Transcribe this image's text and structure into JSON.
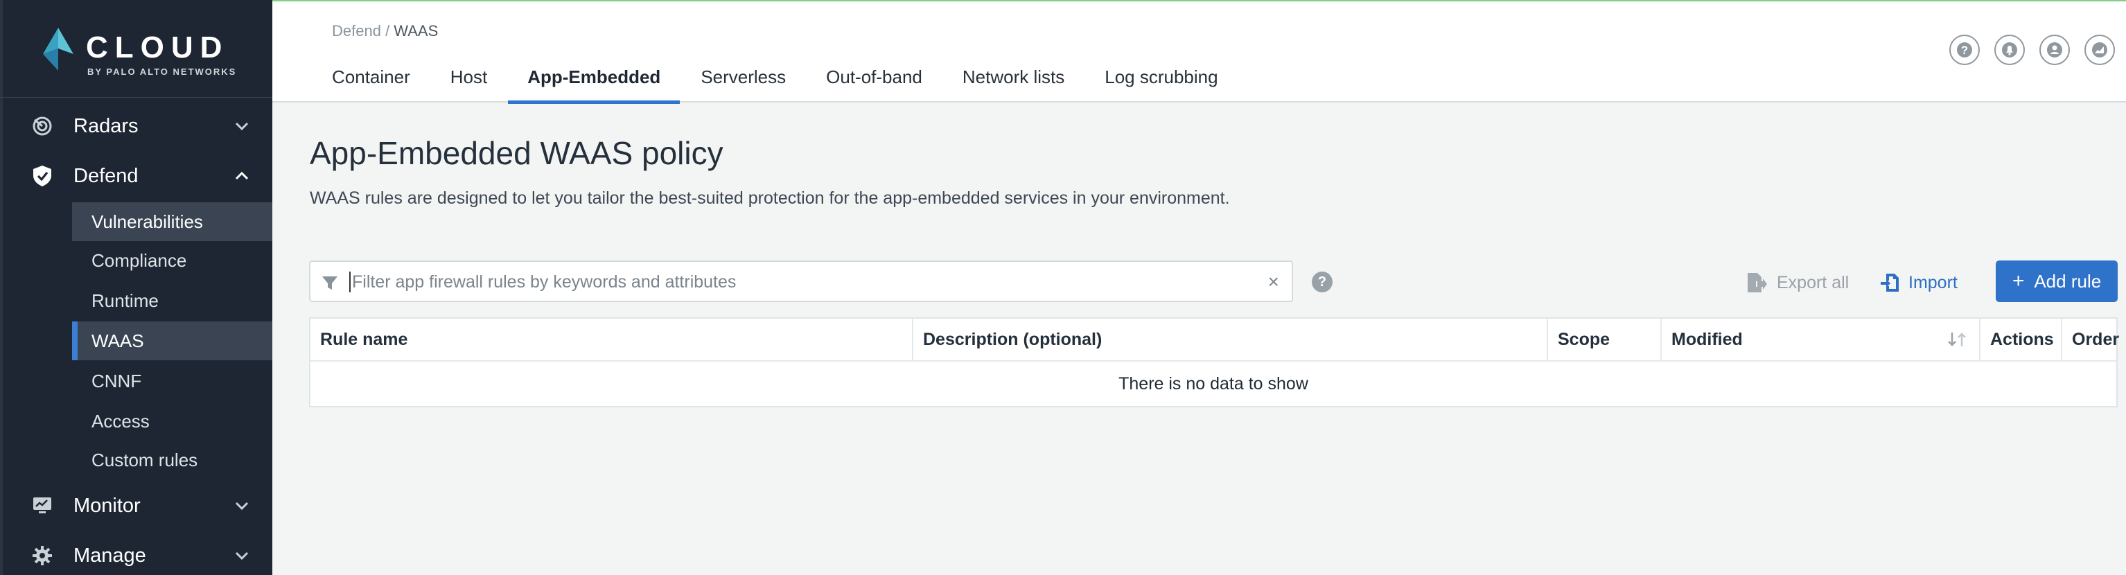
{
  "brand": {
    "name": "CLOUD",
    "sub": "BY PALO ALTO NETWORKS"
  },
  "sidebar": {
    "sections": [
      {
        "label": "Radars",
        "icon": "radar-icon",
        "expanded": false
      },
      {
        "label": "Defend",
        "icon": "shield-icon",
        "expanded": true
      },
      {
        "label": "Monitor",
        "icon": "monitor-icon",
        "expanded": false
      },
      {
        "label": "Manage",
        "icon": "gear-icon",
        "expanded": false
      }
    ],
    "defend_items": [
      {
        "label": "Vulnerabilities"
      },
      {
        "label": "Compliance"
      },
      {
        "label": "Runtime"
      },
      {
        "label": "WAAS"
      },
      {
        "label": "CNNF"
      },
      {
        "label": "Access"
      },
      {
        "label": "Custom rules"
      }
    ]
  },
  "header": {
    "breadcrumb_parent": "Defend",
    "breadcrumb_sep": " / ",
    "breadcrumb_current": "WAAS",
    "tabs": [
      {
        "label": "Container"
      },
      {
        "label": "Host"
      },
      {
        "label": "App-Embedded"
      },
      {
        "label": "Serverless"
      },
      {
        "label": "Out-of-band"
      },
      {
        "label": "Network lists"
      },
      {
        "label": "Log scrubbing"
      }
    ],
    "active_tab": "App-Embedded"
  },
  "main": {
    "title": "App-Embedded WAAS policy",
    "description": "WAAS rules are designed to let you tailor the best-suited protection for the app-embedded services in your environment.",
    "filter_placeholder": "Filter app firewall rules by keywords and attributes",
    "clear_symbol": "×",
    "help_symbol": "?",
    "export_label": "Export all",
    "import_label": "Import",
    "add_label": "Add rule",
    "add_symbol": "+"
  },
  "table": {
    "columns": [
      {
        "label": "Rule name"
      },
      {
        "label": "Description (optional)"
      },
      {
        "label": "Scope"
      },
      {
        "label": "Modified"
      },
      {
        "label": "Actions"
      },
      {
        "label": "Order"
      }
    ],
    "empty_text": "There is no data to show"
  },
  "colors": {
    "accent": "#2f72c9",
    "sidebar_bg": "#1d2632",
    "active_marker": "#3b7ed4"
  }
}
